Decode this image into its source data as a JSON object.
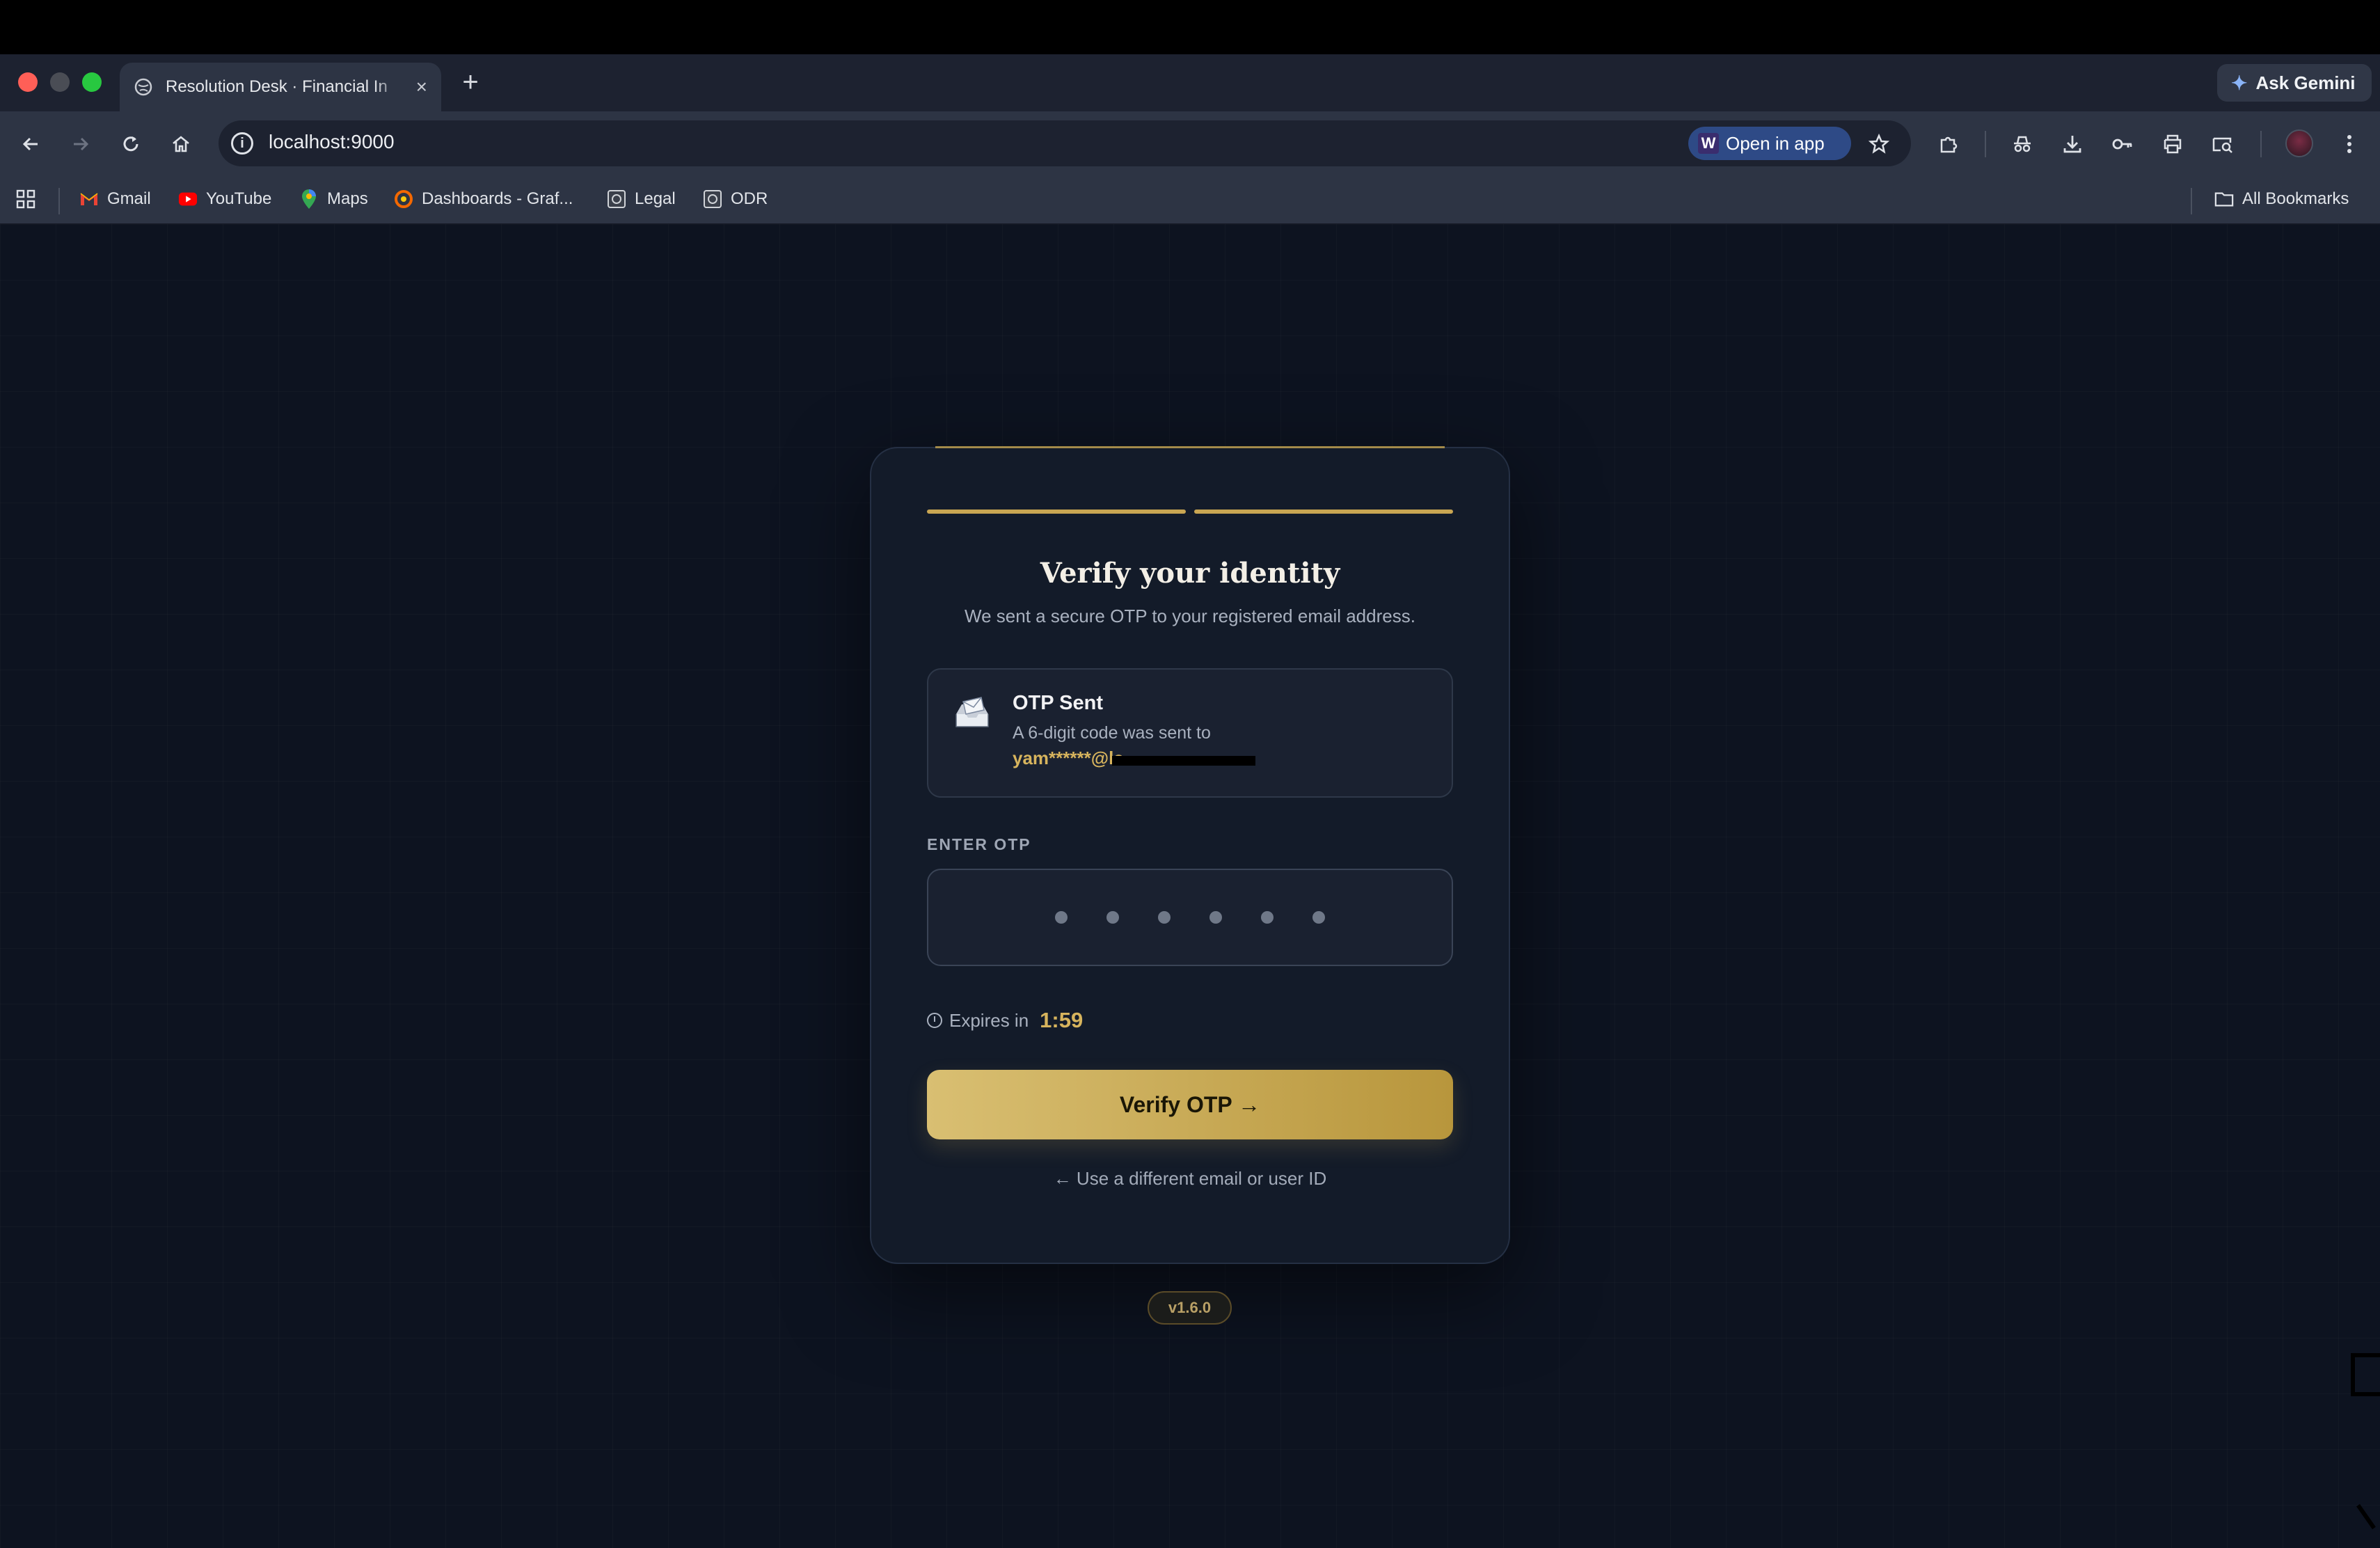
{
  "browser": {
    "tab_title": "Resolution Desk · Financial In",
    "new_tab_symbol": "+",
    "ask_gemini": "Ask Gemini",
    "url": "localhost:9000",
    "open_in_app": "Open in app",
    "bookmarks": [
      "Gmail",
      "YouTube",
      "Maps",
      "Dashboards - Graf...",
      "Legal",
      "ODR"
    ],
    "all_bookmarks": "All Bookmarks"
  },
  "card": {
    "title": "Verify your identity",
    "subtitle": "We sent a secure OTP to your registered email address.",
    "otp_sent_title": "OTP Sent",
    "otp_sent_text": "A 6-digit code was sent to",
    "otp_sent_email": "yam******@la",
    "field_label": "ENTER OTP",
    "otp_placeholder_count": 6,
    "expires_label": "Expires in",
    "expires_time": "1:59",
    "verify_button": "Verify OTP →",
    "back_link": "← Use a different email or user ID"
  },
  "version": "v1.6.0",
  "colors": {
    "accent_gold": "#c9a652",
    "page_bg": "#0d1320",
    "card_bg": "#131b29"
  }
}
